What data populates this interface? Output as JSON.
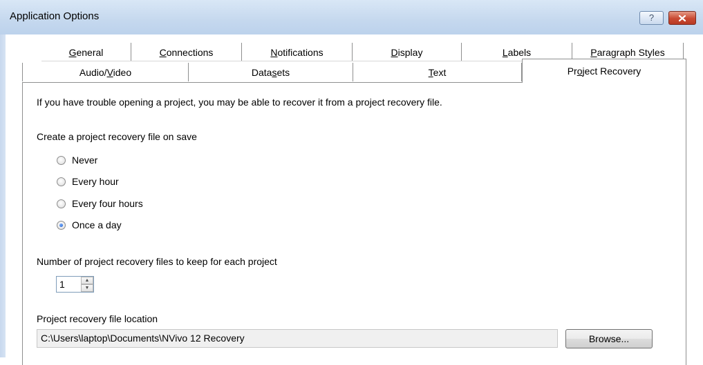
{
  "window": {
    "title": "Application Options",
    "help_label": "?",
    "close_icon": "close-icon"
  },
  "tabs_row1": [
    {
      "label": "General",
      "accel": "G"
    },
    {
      "label": "Connections",
      "accel": "C"
    },
    {
      "label": "Notifications",
      "accel": "N"
    },
    {
      "label": "Display",
      "accel": "D"
    },
    {
      "label": "Labels",
      "accel": "L"
    },
    {
      "label": "Paragraph Styles",
      "accel": "P"
    }
  ],
  "tabs_row2": [
    {
      "label": "Audio/Video",
      "accel": "V"
    },
    {
      "label": "Datasets",
      "accel": "s"
    },
    {
      "label": "Text",
      "accel": "T"
    },
    {
      "label": "Project Recovery",
      "accel": "o",
      "selected": true
    }
  ],
  "panel": {
    "intro": "If you have trouble opening a project, you may be able to recover it from a project recovery file.",
    "create_label": "Create a project recovery file on save",
    "options": [
      {
        "label": "Never",
        "checked": false
      },
      {
        "label": "Every hour",
        "checked": false
      },
      {
        "label": "Every four hours",
        "checked": false
      },
      {
        "label": "Once a day",
        "checked": true
      }
    ],
    "keep_label": "Number of project recovery files to keep for each project",
    "keep_value": "1",
    "location_label": "Project recovery file location",
    "location_value": "C:\\Users\\laptop\\Documents\\NVivo 12 Recovery",
    "browse_label": "Browse..."
  },
  "colors": {
    "title_bar": "#c5d8ee",
    "close_button": "#c94a33",
    "radio_dot": "#1656c8"
  }
}
